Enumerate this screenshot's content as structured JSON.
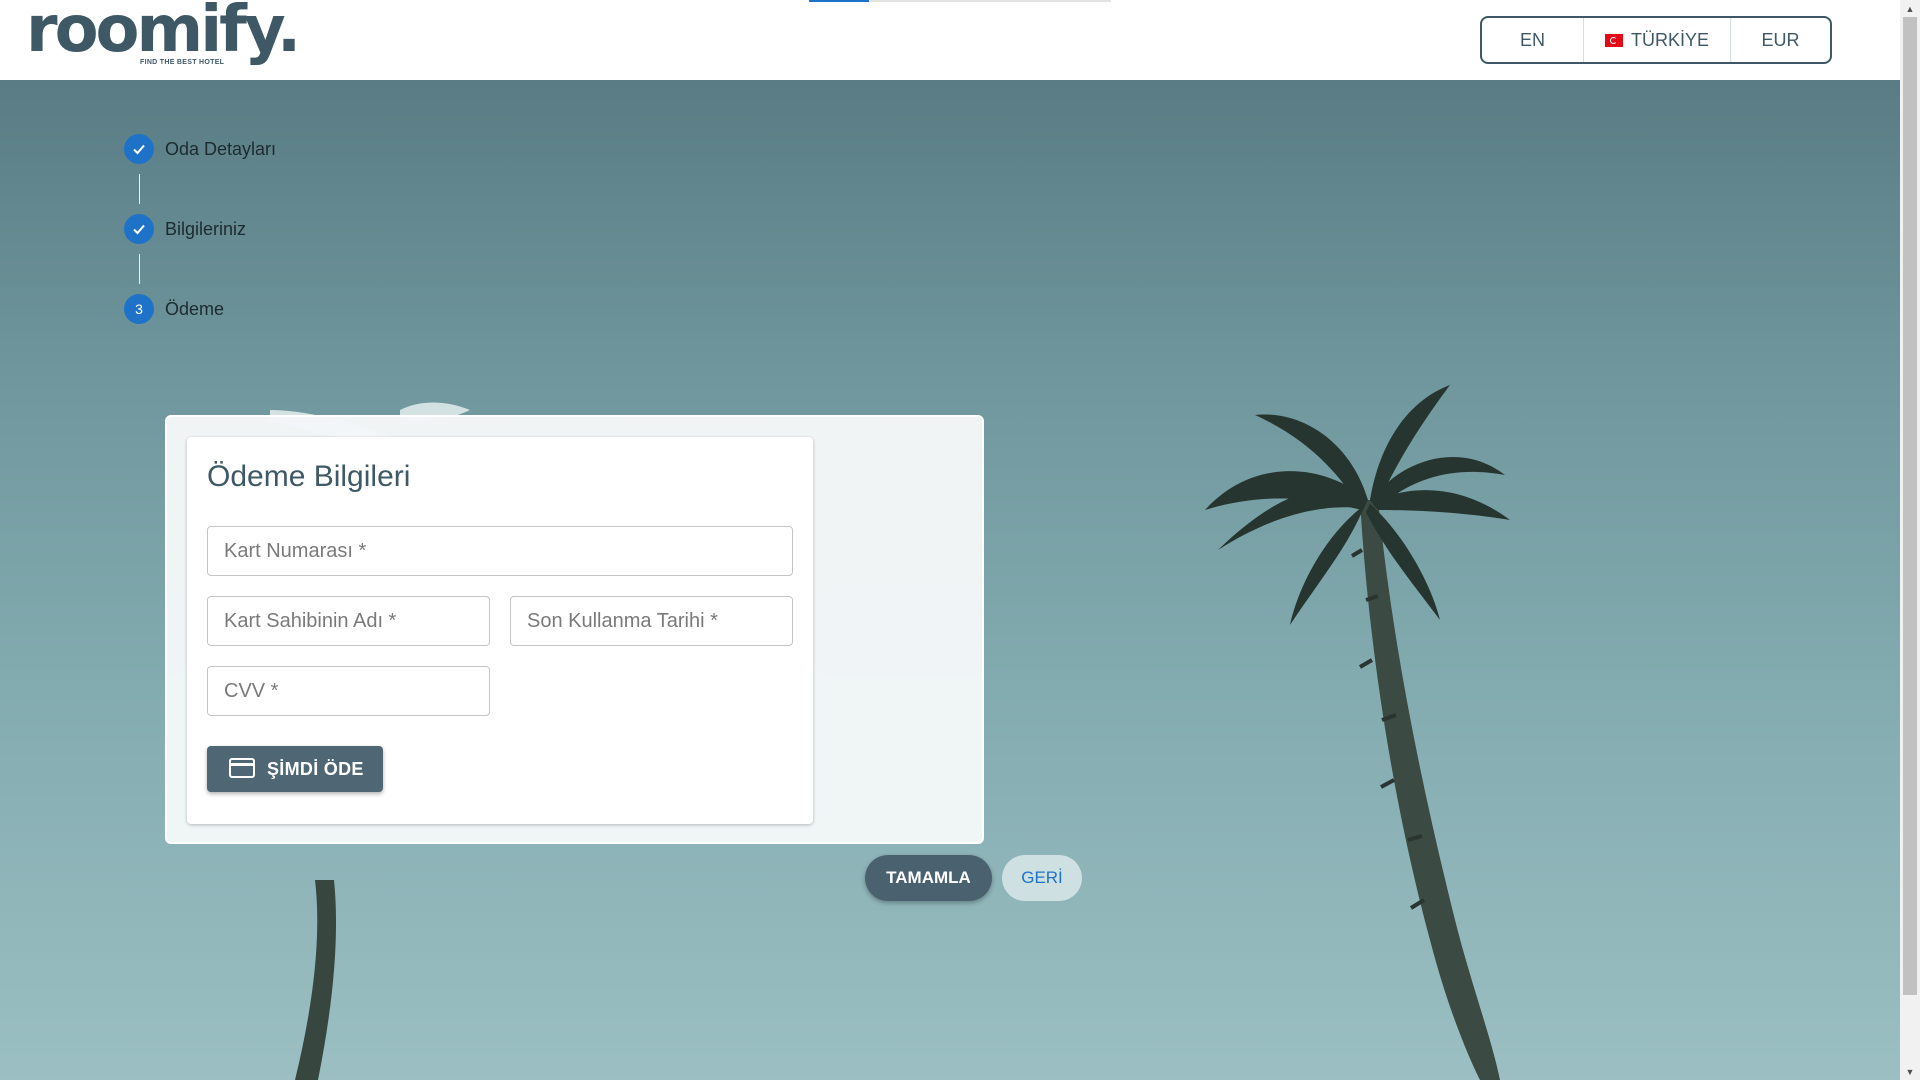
{
  "brand": {
    "name": "roomify.",
    "tagline": "FIND THE BEST HOTEL"
  },
  "header": {
    "language": "EN",
    "country": "TÜRKİYE",
    "country_flag": "turkey-flag-icon",
    "currency": "EUR"
  },
  "stepper": {
    "steps": [
      {
        "label": "Oda Detayları",
        "state": "completed",
        "icon": "check-icon"
      },
      {
        "label": "Bilgileriniz",
        "state": "completed",
        "icon": "check-icon"
      },
      {
        "label": "Ödeme",
        "state": "active",
        "number": "3"
      }
    ]
  },
  "payment": {
    "title": "Ödeme Bilgileri",
    "card_number_placeholder": "Kart Numarası *",
    "card_holder_placeholder": "Kart Sahibinin Adı *",
    "expiry_placeholder": "Son Kullanma Tarihi *",
    "cvv_placeholder": "CVV *",
    "pay_label": "ŞİMDİ ÖDE",
    "pay_icon": "credit-card-icon"
  },
  "actions": {
    "complete_label": "TAMAMLA",
    "back_label": "GERİ"
  },
  "colors": {
    "primary": "#4f6775",
    "accent": "#1e73c9",
    "brand": "#3f5866"
  }
}
